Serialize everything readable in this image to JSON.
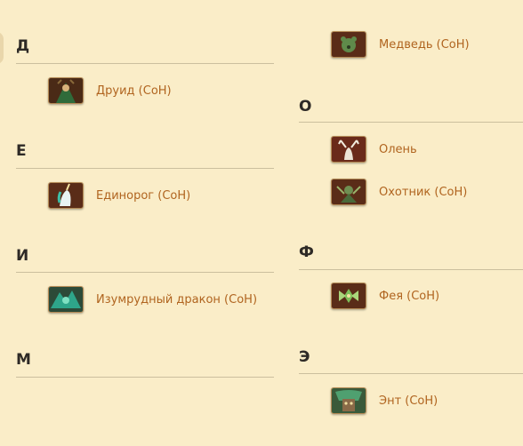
{
  "left_column": {
    "sections": [
      {
        "letter": "Д",
        "items": [
          {
            "label": "Друид (СоН)",
            "icon": "druid-portrait-icon"
          }
        ]
      },
      {
        "letter": "Е",
        "items": [
          {
            "label": "Единорог (СоН)",
            "icon": "unicorn-portrait-icon"
          }
        ]
      },
      {
        "letter": "И",
        "items": [
          {
            "label": "Изумрудный дракон (СоН)",
            "icon": "emerald-dragon-portrait-icon"
          }
        ]
      },
      {
        "letter": "М",
        "items": []
      }
    ]
  },
  "right_column": {
    "top_items": [
      {
        "label": "Медведь (СоН)",
        "icon": "bear-portrait-icon"
      }
    ],
    "sections": [
      {
        "letter": "О",
        "items": [
          {
            "label": "Олень",
            "icon": "deer-portrait-icon"
          },
          {
            "label": "Охотник (СоН)",
            "icon": "hunter-portrait-icon"
          }
        ]
      },
      {
        "letter": "Ф",
        "items": [
          {
            "label": "Фея (СоН)",
            "icon": "fairy-portrait-icon"
          }
        ]
      },
      {
        "letter": "Э",
        "items": [
          {
            "label": "Энт (СоН)",
            "icon": "ent-portrait-icon"
          }
        ]
      }
    ]
  },
  "colors": {
    "background": "#faedc8",
    "link": "#b0641f",
    "heading": "#2e2a26",
    "rule": "#cbbf9e"
  }
}
